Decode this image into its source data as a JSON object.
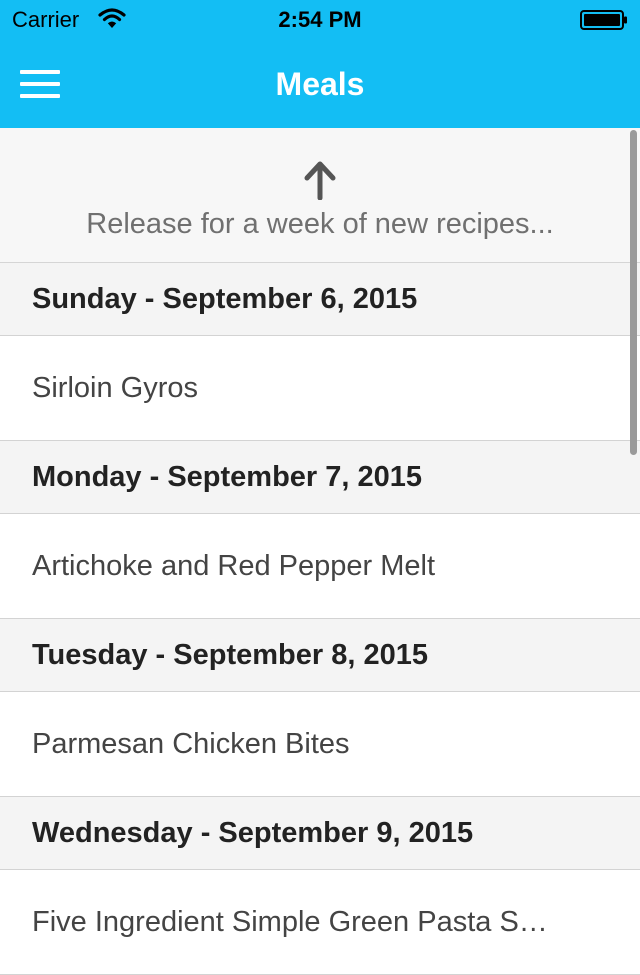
{
  "status_bar": {
    "carrier": "Carrier",
    "time": "2:54 PM",
    "wifi_icon": "wifi-icon",
    "battery_icon": "battery-icon"
  },
  "nav": {
    "title": "Meals",
    "menu_icon": "hamburger-menu-icon",
    "background_color": "#13bef4"
  },
  "refresh": {
    "arrow_icon": "arrow-up-icon",
    "text": "Release for a week of new recipes..."
  },
  "days": [
    {
      "header": "Sunday - September 6, 2015",
      "meal": "Sirloin Gyros"
    },
    {
      "header": "Monday - September 7, 2015",
      "meal": "Artichoke and Red Pepper Melt"
    },
    {
      "header": "Tuesday - September 8, 2015",
      "meal": "Parmesan Chicken Bites"
    },
    {
      "header": "Wednesday - September 9, 2015",
      "meal": "Five Ingredient Simple Green Pasta S…"
    }
  ]
}
